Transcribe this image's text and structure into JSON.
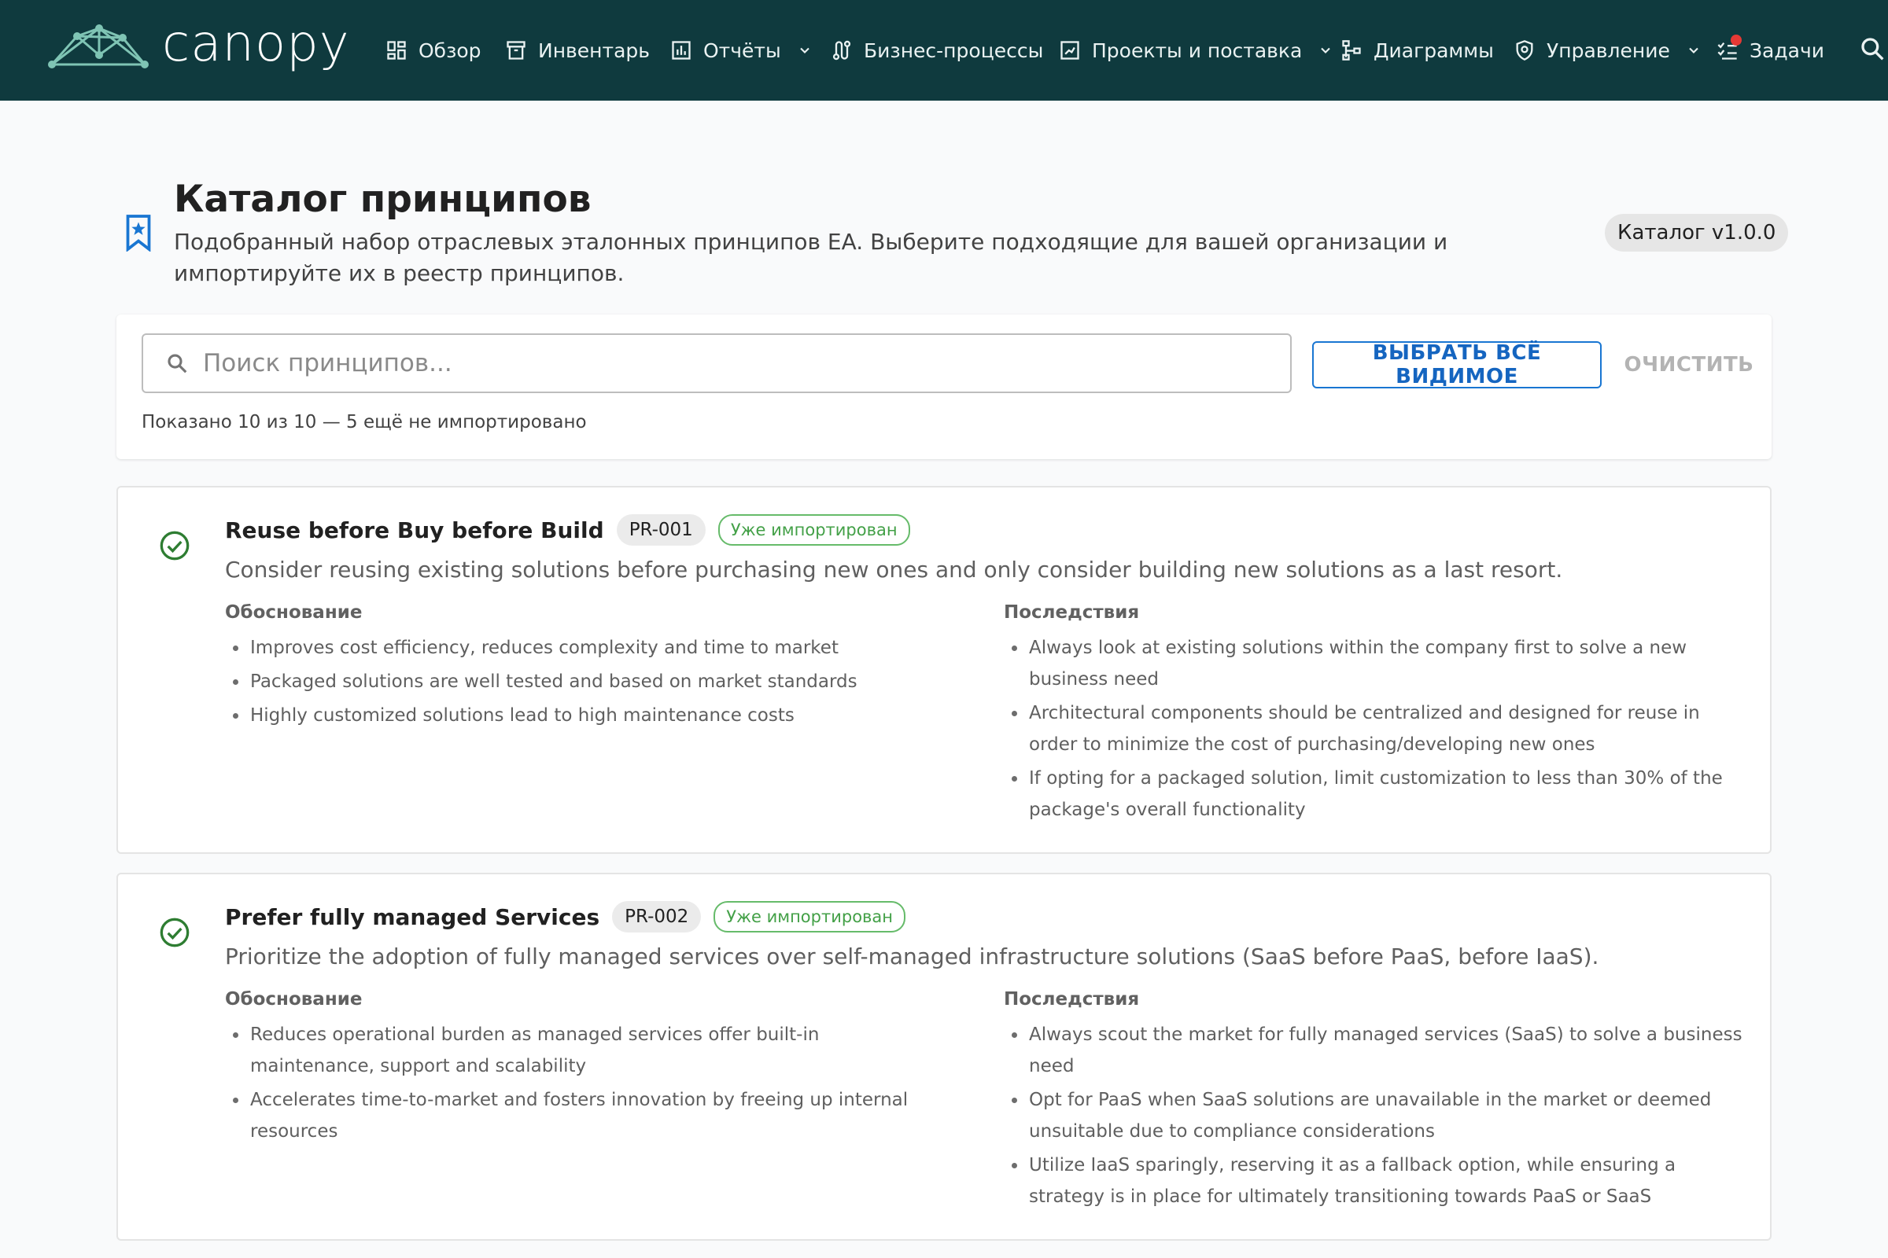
{
  "app": {
    "brand": "canopy",
    "brand_color": "#0f3a3e",
    "nav": [
      {
        "label": "Обзор",
        "icon": "dashboard-icon"
      },
      {
        "label": "Инвентарь",
        "icon": "archive-box-icon"
      },
      {
        "label": "Отчёты",
        "icon": "bar-chart-icon",
        "dropdown": true
      },
      {
        "label": "Бизнес-процессы",
        "icon": "process-flow-icon"
      },
      {
        "label": "Проекты и поставка",
        "icon": "project-board-icon",
        "dropdown": true
      },
      {
        "label": "Диаграммы",
        "icon": "diagram-tree-icon"
      },
      {
        "label": "Управление",
        "icon": "shield-icon",
        "dropdown": true
      },
      {
        "label": "Задачи",
        "icon": "checklist-icon",
        "notification_dot": true
      }
    ],
    "search_icon": "search-icon"
  },
  "header": {
    "title": "Каталог принципов",
    "subtitle": "Подобранный набор отраслевых эталонных принципов EA. Выберите подходящие для вашей организации и импортируйте их в реестр принципов.",
    "version": "Каталог v1.0.0",
    "icon": "bookmark-star-icon"
  },
  "toolbar": {
    "search_placeholder": "Поиск принципов...",
    "search_value": "",
    "select_all_label": "ВЫБРАТЬ ВСЁ ВИДИМОЕ",
    "clear_label": "ОЧИСТИТЬ",
    "shown_count": "Показано 10 из 10 — 5 ещё не импортировано"
  },
  "principles": [
    {
      "title": "Reuse before Buy before Build",
      "id": "PR-001",
      "status": "Уже импортирован",
      "description": "Consider reusing existing solutions before purchasing new ones and only consider building new solutions as a last resort.",
      "rationale_label": "Обоснование",
      "rationale": [
        "Improves cost efficiency, reduces complexity and time to market",
        "Packaged solutions are well tested and based on market standards",
        "Highly customized solutions lead to high maintenance costs"
      ],
      "implications_label": "Последствия",
      "implications": [
        "Always look at existing solutions within the company first to solve a new business need",
        "Architectural components should be centralized and designed for reuse in order to minimize the cost of purchasing/developing new ones",
        "If opting for a packaged solution, limit customization to less than 30% of the package's overall functionality"
      ]
    },
    {
      "title": "Prefer fully managed Services",
      "id": "PR-002",
      "status": "Уже импортирован",
      "description": "Prioritize the adoption of fully managed services over self-managed infrastructure solutions (SaaS before PaaS, before IaaS).",
      "rationale_label": "Обоснование",
      "rationale": [
        "Reduces operational burden as managed services offer built-in maintenance, support and scalability",
        "Accelerates time-to-market and fosters innovation by freeing up internal resources"
      ],
      "implications_label": "Последствия",
      "implications": [
        "Always scout the market for fully managed services (SaaS) to solve a business need",
        "Opt for PaaS when SaaS solutions are unavailable in the market or deemed unsuitable due to compliance considerations",
        "Utilize IaaS sparingly, reserving it as a fallback option, while ensuring a strategy is in place for ultimately transitioning towards PaaS or SaaS"
      ]
    }
  ]
}
